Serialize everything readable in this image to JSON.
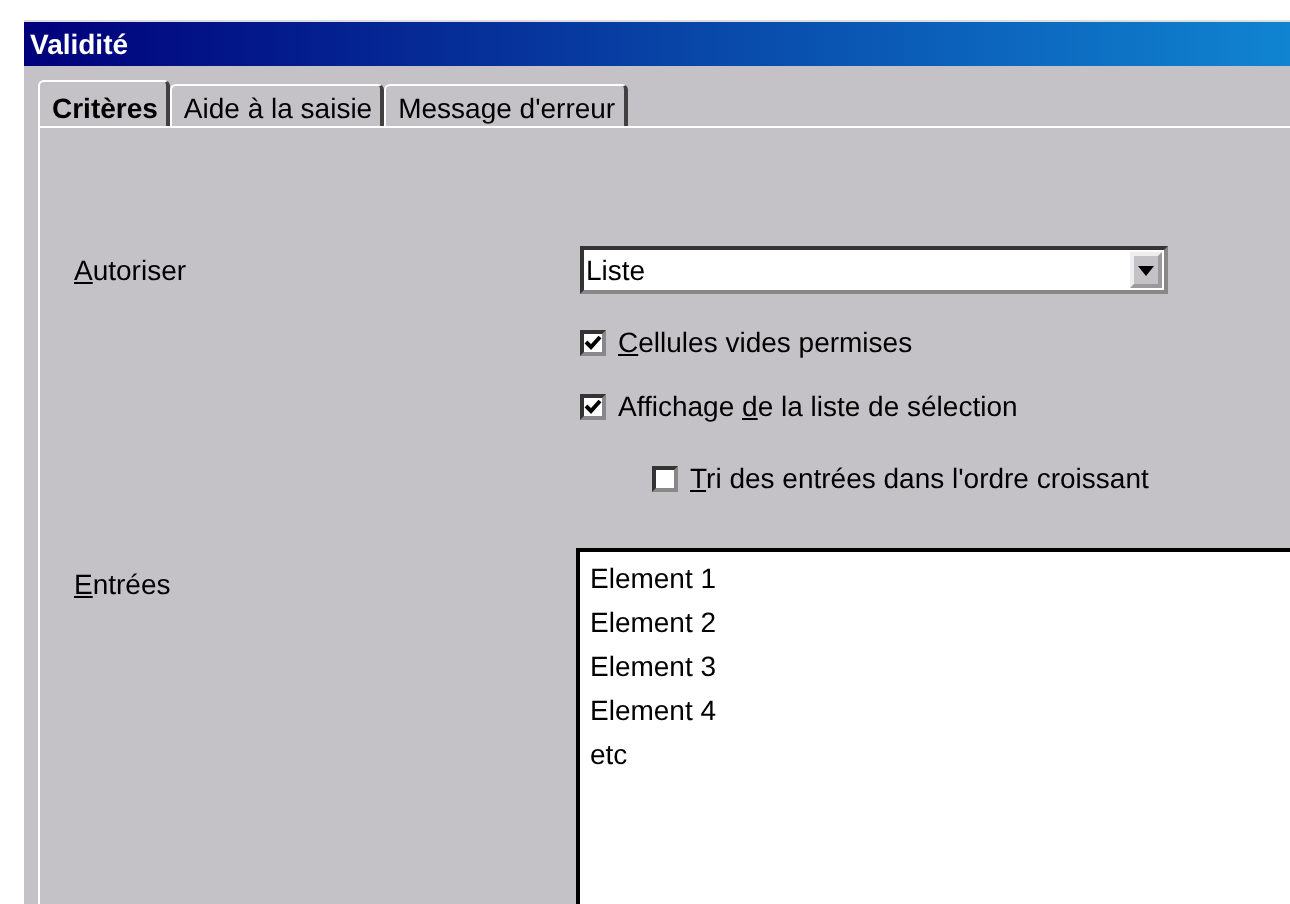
{
  "window": {
    "title": "Validité"
  },
  "tabs": [
    {
      "label": "Critères",
      "selected": true
    },
    {
      "label": "Aide à la saisie",
      "selected": false
    },
    {
      "label": "Message d'erreur",
      "selected": false
    }
  ],
  "allow": {
    "label": [
      {
        "text": "A",
        "underlined": true
      },
      {
        "text": "utoriser",
        "underlined": false
      }
    ],
    "value": "Liste"
  },
  "options": [
    {
      "label": [
        {
          "text": "C",
          "underlined": true
        },
        {
          "text": "ellules vides permises",
          "underlined": false
        }
      ],
      "checked": true,
      "indented": false
    },
    {
      "label": [
        {
          "text": "Affichage ",
          "underlined": false
        },
        {
          "text": "d",
          "underlined": true
        },
        {
          "text": "e la liste de sélection",
          "underlined": false
        }
      ],
      "checked": true,
      "indented": false
    },
    {
      "label": [
        {
          "text": "T",
          "underlined": true
        },
        {
          "text": "ri des entrées dans l'ordre croissant",
          "underlined": false
        }
      ],
      "checked": false,
      "indented": true
    }
  ],
  "entries": {
    "label": [
      {
        "text": "E",
        "underlined": true
      },
      {
        "text": "ntrées",
        "underlined": false
      }
    ],
    "lines": [
      "Element 1",
      "Element 2",
      "Element 3",
      "Element 4",
      "etc"
    ]
  }
}
